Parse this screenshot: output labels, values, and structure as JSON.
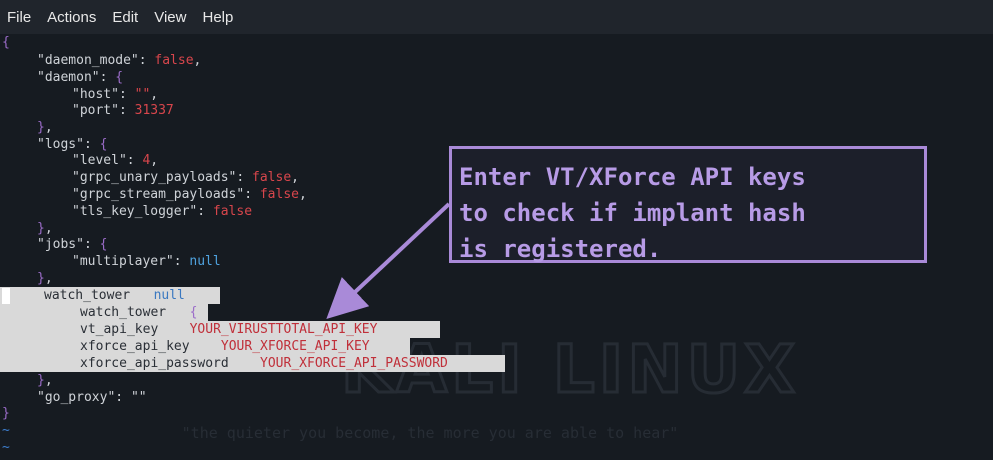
{
  "menu": {
    "items": [
      {
        "label": "File"
      },
      {
        "label": "Actions"
      },
      {
        "label": "Edit"
      },
      {
        "label": "View"
      },
      {
        "label": "Help"
      }
    ]
  },
  "code": {
    "open_brace": "{",
    "daemon_mode_key": "\"daemon_mode\"",
    "daemon_mode_val": "false",
    "daemon_key": "\"daemon\"",
    "host_key": "\"host\"",
    "host_val": "\"\"",
    "port_key": "\"port\"",
    "port_val": "31337",
    "logs_key": "\"logs\"",
    "level_key": "\"level\"",
    "level_val": "4",
    "grpc_unary_key": "\"grpc_unary_payloads\"",
    "grpc_unary_val": "false",
    "grpc_stream_key": "\"grpc_stream_payloads\"",
    "grpc_stream_val": "false",
    "tls_key": "\"tls_key_logger\"",
    "tls_val": "false",
    "jobs_key": "\"jobs\"",
    "multiplayer_key": "\"multiplayer\"",
    "multiplayer_val": "null",
    "watch_tower_outer_key": "watch_tower",
    "watch_tower_outer_val": "null",
    "watch_tower_inner_key": "watch_tower",
    "vt_key": "vt_api_key",
    "vt_val": "YOUR_VIRUSTTOTAL_API_KEY",
    "xforce_key": "xforce_api_key",
    "xforce_val": "YOUR_XFORCE_API_KEY",
    "xforce_pw_key": "xforce_api_password",
    "xforce_pw_val": "YOUR_XFORCE_API_PASSWORD",
    "go_proxy_key": "\"go_proxy\"",
    "go_proxy_val": "\"\"",
    "close_brace": "}",
    "tilde": "~"
  },
  "watermark": {
    "logo_text": "KALI LINUX",
    "tagline": "\"the quieter you become, the more you are able to hear\""
  },
  "callout": {
    "text": "Enter VT/XForce API keys\nto check if implant hash\nis registered."
  },
  "colors": {
    "background": "#161b21",
    "callout_border": "#a98ad8",
    "callout_text": "#b79be6",
    "value_red": "#d8464c",
    "null_blue": "#4fa3e0",
    "brace_purple": "#9b6cc9"
  }
}
